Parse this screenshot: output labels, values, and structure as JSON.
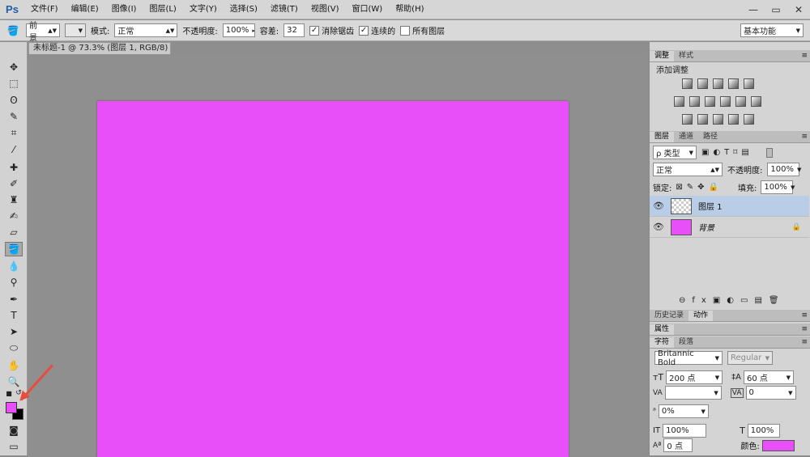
{
  "app": {
    "logo": "Ps"
  },
  "menu": [
    "文件(F)",
    "编辑(E)",
    "图像(I)",
    "图层(L)",
    "文字(Y)",
    "选择(S)",
    "滤镜(T)",
    "视图(V)",
    "窗口(W)",
    "帮助(H)"
  ],
  "window_controls": {
    "minimize": "—",
    "restore": "▭",
    "close": "✕"
  },
  "options": {
    "fill_source": "前景",
    "mode_label": "模式:",
    "mode_value": "正常",
    "opacity_label": "不透明度:",
    "opacity_value": "100%",
    "tolerance_label": "容差:",
    "tolerance_value": "32",
    "antialias_label": "消除锯齿",
    "contiguous_label": "连续的",
    "all_layers_label": "所有图层",
    "workspace": "基本功能"
  },
  "document": {
    "tab_title": "未标题-1 @ 73.3% (图层 1, RGB/8) *",
    "canvas_color": "#e94ff8"
  },
  "panels": {
    "adjust": {
      "tab1": "调整",
      "tab2": "样式",
      "title": "添加调整"
    },
    "layers": {
      "tab1": "图层",
      "tab2": "通道",
      "tab3": "路径",
      "filter": "ρ 类型",
      "blend": "正常",
      "opacity_label": "不透明度:",
      "opacity_value": "100%",
      "lock_label": "锁定:",
      "fill_label": "填充:",
      "fill_value": "100%",
      "items": [
        {
          "name": "图层 1",
          "selected": true
        },
        {
          "name": "背景",
          "selected": false
        }
      ]
    },
    "history": {
      "tab1": "历史记录",
      "tab2": "动作"
    },
    "properties": {
      "title": "属性"
    },
    "character": {
      "tab1": "字符",
      "tab2": "段落",
      "font": "Britannic Bold",
      "style": "Regular",
      "size": "200 点",
      "leading": "60 点",
      "kerning_label": "VA",
      "tracking": "0",
      "scale_pct": "0%",
      "vscale": "100%",
      "hscale": "100%",
      "baseline": "0 点",
      "color_label": "颜色:"
    }
  }
}
